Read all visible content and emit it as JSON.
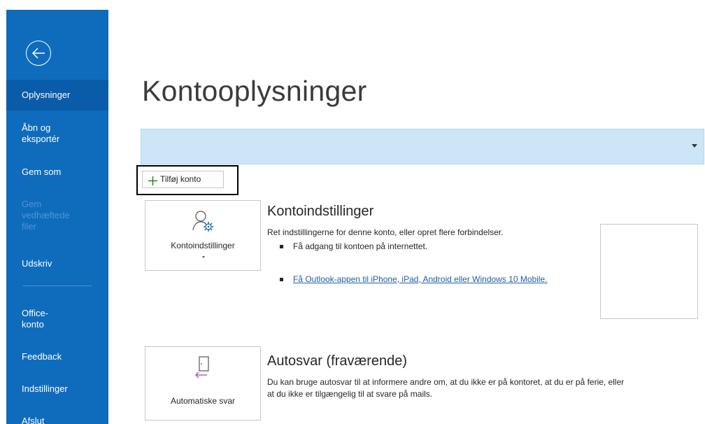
{
  "sidebar": {
    "items": [
      {
        "label": "Oplysninger",
        "state": "active"
      },
      {
        "label": "Åbn og\neksportér",
        "state": "normal"
      },
      {
        "label": "Gem som",
        "state": "normal"
      },
      {
        "label": "Gem\nvedhæftede\nfiler",
        "state": "disabled"
      },
      {
        "label": "Udskriv",
        "state": "normal"
      },
      {
        "label": "Office-\nkonto",
        "state": "normal"
      },
      {
        "label": "Feedback",
        "state": "normal"
      },
      {
        "label": "Indstillinger",
        "state": "normal"
      },
      {
        "label": "Afslut",
        "state": "normal"
      }
    ],
    "back_icon": "arrow-left-circle-icon",
    "bg_color": "#0f6cbd"
  },
  "main": {
    "title": "Kontooplysninger",
    "account_select": {
      "value": ""
    },
    "add_account_label": "Tilføj konto",
    "account_settings": {
      "tile_label": "Kontoindstillinger",
      "title": "Kontoindstillinger",
      "description": "Ret indstillingerne for denne konto, eller opret flere forbindelser.",
      "bullets": [
        "Få adgang til kontoen på internettet.",
        "Få Outlook-appen til iPhone, iPad, Android eller Windows 10 Mobile."
      ]
    },
    "auto_reply": {
      "tile_label": "Automatiske svar",
      "title": "Autosvar (fraværende)",
      "description_line1": "Du kan bruge autosvar til at informere andre om, at du ikke er på kontoret, at du er på ferie, eller",
      "description_line2": "at du ikke er tilgængelig til at svare på mails."
    }
  },
  "colors": {
    "accent": "#0f6cbd",
    "select_bg": "#cde6f7",
    "link": "#1f5ea8",
    "plus": "#107c10"
  }
}
